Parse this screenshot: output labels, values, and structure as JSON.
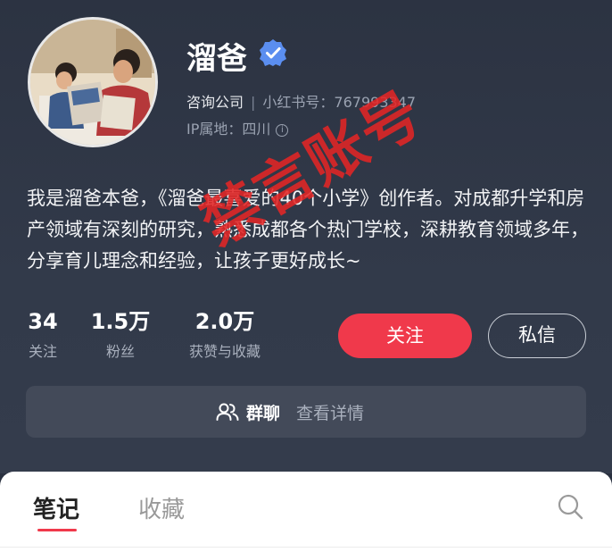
{
  "profile": {
    "name": "溜爸",
    "company": "咨询公司",
    "xhs_label": "小红书号：",
    "xhs_id": "767993347",
    "ip_label": "IP属地：",
    "ip_location": "四川",
    "info_icon_glyph": "i",
    "bio": "我是溜爸本爸，《溜爸最喜爱的40个小学》创作者。对成都升学和房产领域有深刻的研究，熟悉成都各个热门学校，深耕教育领域多年，分享育儿理念和经验，让孩子更好成长~"
  },
  "stats": [
    {
      "value": "34",
      "label": "关注"
    },
    {
      "value": "1.5万",
      "label": "粉丝"
    },
    {
      "value": "2.0万",
      "label": "获赞与收藏"
    }
  ],
  "actions": {
    "follow_label": "关注",
    "message_label": "私信"
  },
  "group": {
    "label": "群聊",
    "detail": "查看详情"
  },
  "stamp": {
    "text": "禁言账号",
    "color": "#e22626"
  },
  "tabs": {
    "notes": "笔记",
    "favorites": "收藏"
  },
  "colors": {
    "accent": "#f0394b",
    "verified": "#5b8ef0",
    "background": "#2c3342"
  },
  "icons": [
    "verified-badge-icon",
    "info-icon",
    "group-chat-icon",
    "search-icon"
  ]
}
